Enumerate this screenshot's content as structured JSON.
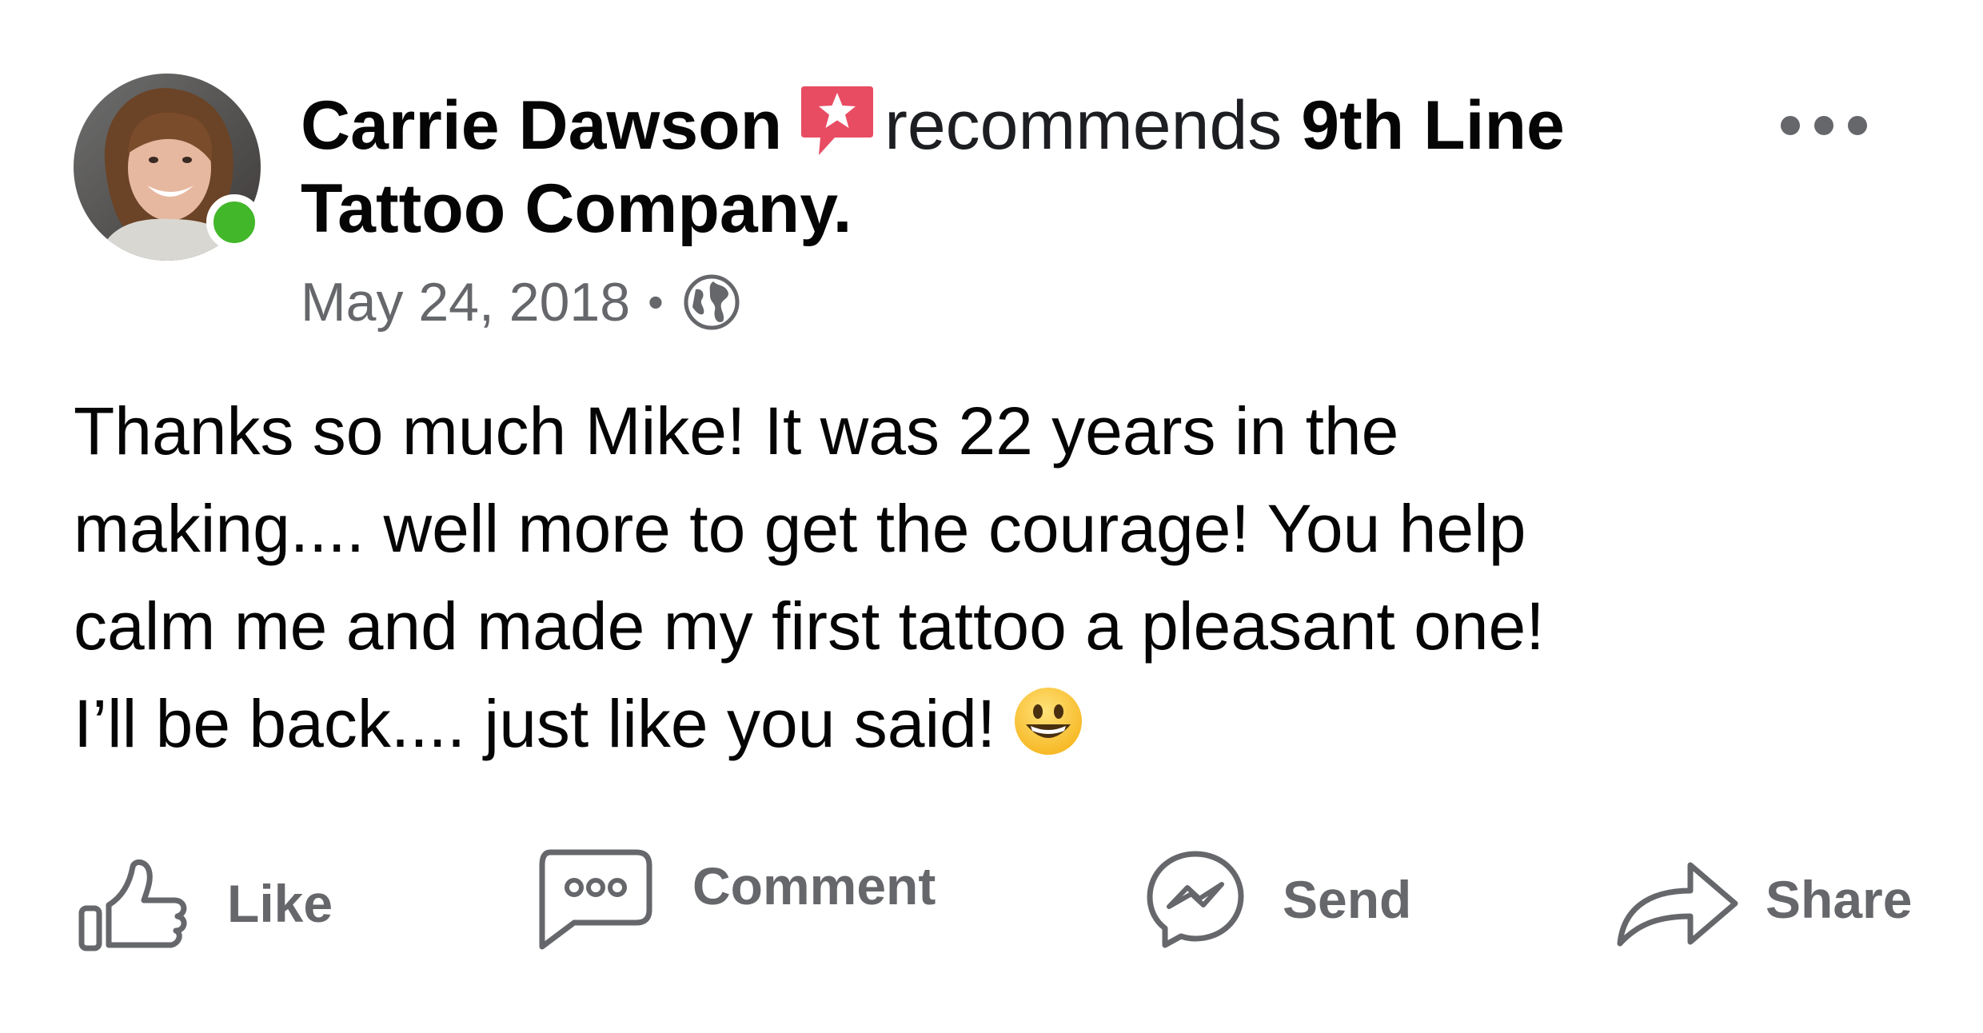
{
  "post": {
    "author_name": "Carrie Dawson",
    "verb": "recommends",
    "page_name": "9th Line Tattoo Company.",
    "date": "May 24, 2018",
    "separator": "•",
    "body": "Thanks so much Mike! It was 22 years in the\nmaking.... well more to get the courage! You help\ncalm me and made my first tattoo a pleasant one!\nI’ll be back.... just like you said!",
    "author_online": true
  },
  "actions": {
    "like": "Like",
    "comment": "Comment",
    "send": "Send",
    "share": "Share"
  },
  "icons": {
    "recommend_badge": "recommend-star-icon",
    "privacy": "globe-icon",
    "more": "more-options-icon",
    "emoji": "grinning-face-emoji"
  },
  "colors": {
    "recommend_badge": "#e84c63",
    "online": "#42b72a",
    "secondary_text": "#65676b",
    "primary_text": "#050505"
  }
}
